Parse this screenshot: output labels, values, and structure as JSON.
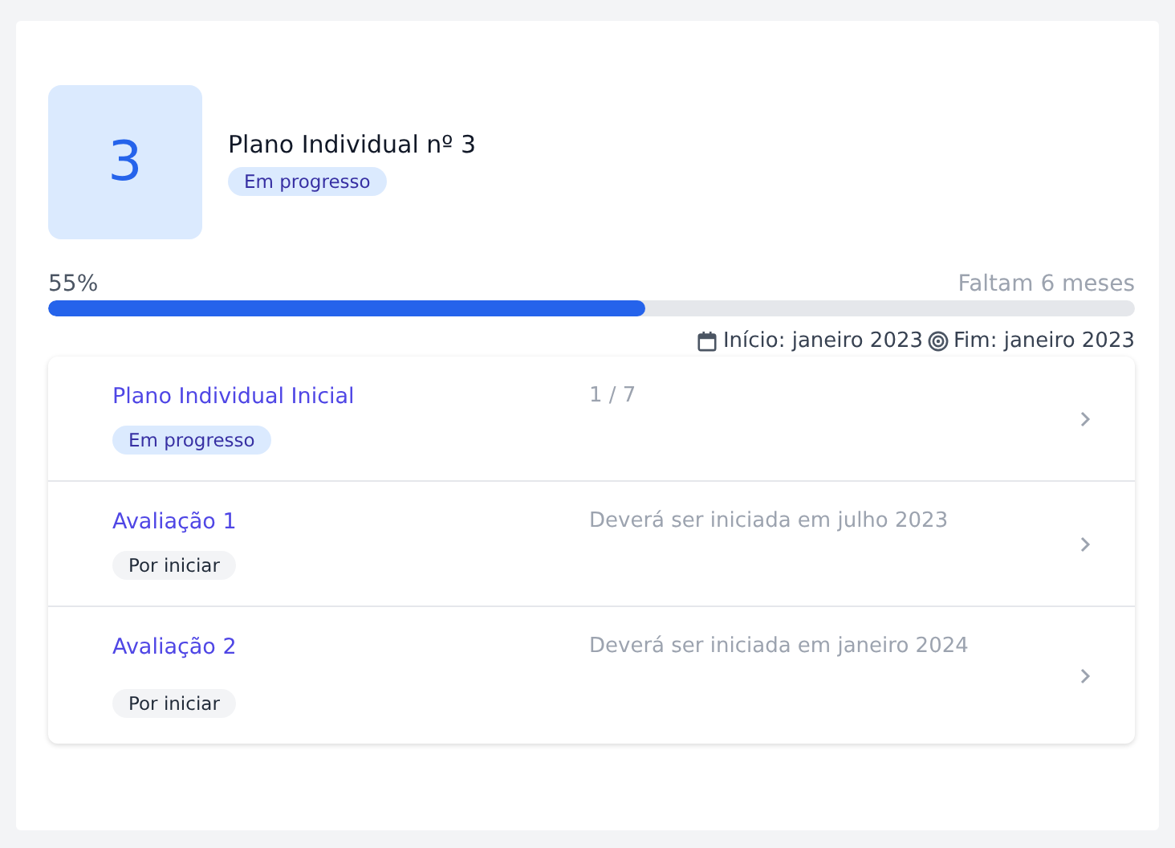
{
  "plan": {
    "number": "3",
    "title": "Plano Individual nº 3",
    "status": {
      "label": "Em progresso",
      "kind": "in_progress"
    }
  },
  "progress": {
    "percent": "55%",
    "level": 0.55,
    "remaining": "Faltam 6 meses"
  },
  "dates": {
    "start": "Início: janeiro 2023",
    "end": "Fim: janeiro 2023"
  },
  "items": [
    {
      "title": "Plano Individual Inicial",
      "status": {
        "label": "Em progresso",
        "kind": "in_progress"
      },
      "info": "1 / 7"
    },
    {
      "title": "Avaliação 1",
      "status": {
        "label": "Por iniciar",
        "kind": "not_started"
      },
      "info": "Deverá ser iniciada em julho 2023"
    },
    {
      "title": "Avaliação 2",
      "status": {
        "label": "Por iniciar",
        "kind": "not_started"
      },
      "info": "Deverá ser iniciada em janeiro 2024"
    }
  ]
}
